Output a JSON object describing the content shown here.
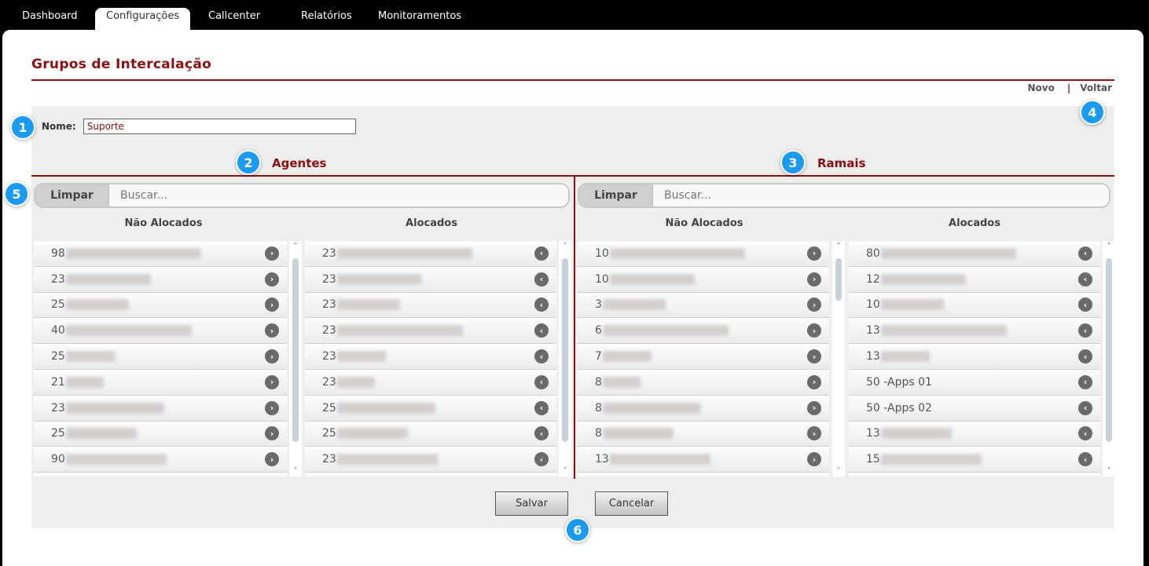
{
  "nav": {
    "tabs": [
      "Dashboard",
      "Configurações",
      "Callcenter",
      "Relatórios",
      "Monitoramentos"
    ],
    "active": "Configurações"
  },
  "page": {
    "title": "Grupos de Intercalação",
    "links": {
      "new": "Novo",
      "separator": "|",
      "back": "Voltar"
    }
  },
  "form": {
    "name_label": "Nome:",
    "name_value": "Suporte",
    "save": "Salvar",
    "cancel": "Cancelar"
  },
  "agents": {
    "title": "Agentes",
    "clear": "Limpar",
    "search_placeholder": "Buscar...",
    "not_allocated_label": "Não Alocados",
    "allocated_label": "Alocados",
    "not_allocated": [
      "98",
      "23",
      "25",
      "40",
      "25",
      "21",
      "23",
      "25",
      "90"
    ],
    "allocated": [
      "23",
      "23",
      "23",
      "23",
      "23",
      "23",
      "25",
      "25",
      "23"
    ]
  },
  "extensions": {
    "title": "Ramais",
    "clear": "Limpar",
    "search_placeholder": "Buscar...",
    "not_allocated_label": "Não Alocados",
    "allocated_label": "Alocados",
    "not_allocated": [
      "10",
      "10",
      "3",
      "6",
      "7",
      "8",
      "8",
      "8",
      "13"
    ],
    "allocated": [
      "80",
      "12",
      "10",
      "13",
      "13",
      "50 -Apps 01",
      "50 -Apps 02",
      "13",
      "15"
    ]
  },
  "badges": [
    "1",
    "2",
    "3",
    "4",
    "5",
    "6"
  ],
  "icons": {
    "move_right": "chevron-right-icon",
    "move_left": "chevron-left-icon",
    "scroll_up": "caret-up-icon",
    "scroll_down": "caret-down-icon"
  },
  "colors": {
    "accent": "#8b0f0f",
    "badge": "#1a9af0",
    "panel": "#eeeeee"
  }
}
